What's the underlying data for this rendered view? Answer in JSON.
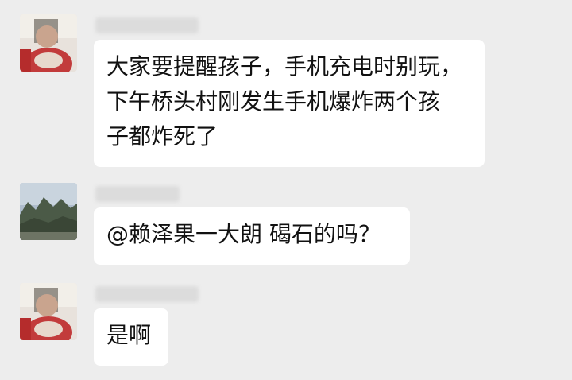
{
  "messages": [
    {
      "sender": "",
      "lines": [
        "大家要提醒孩子，手机充电时别玩，",
        "下午桥头村刚发生手机爆炸两个孩",
        "子都炸死了"
      ],
      "avatar": "person-avatar"
    },
    {
      "sender": "",
      "lines": [
        "@赖泽果一大朗  碣石的吗？"
      ],
      "avatar": "landscape-avatar"
    },
    {
      "sender": "",
      "lines": [
        "是啊"
      ],
      "avatar": "person-avatar"
    }
  ],
  "colors": {
    "background": "#ededed",
    "bubble": "#ffffff",
    "text": "#111111"
  }
}
